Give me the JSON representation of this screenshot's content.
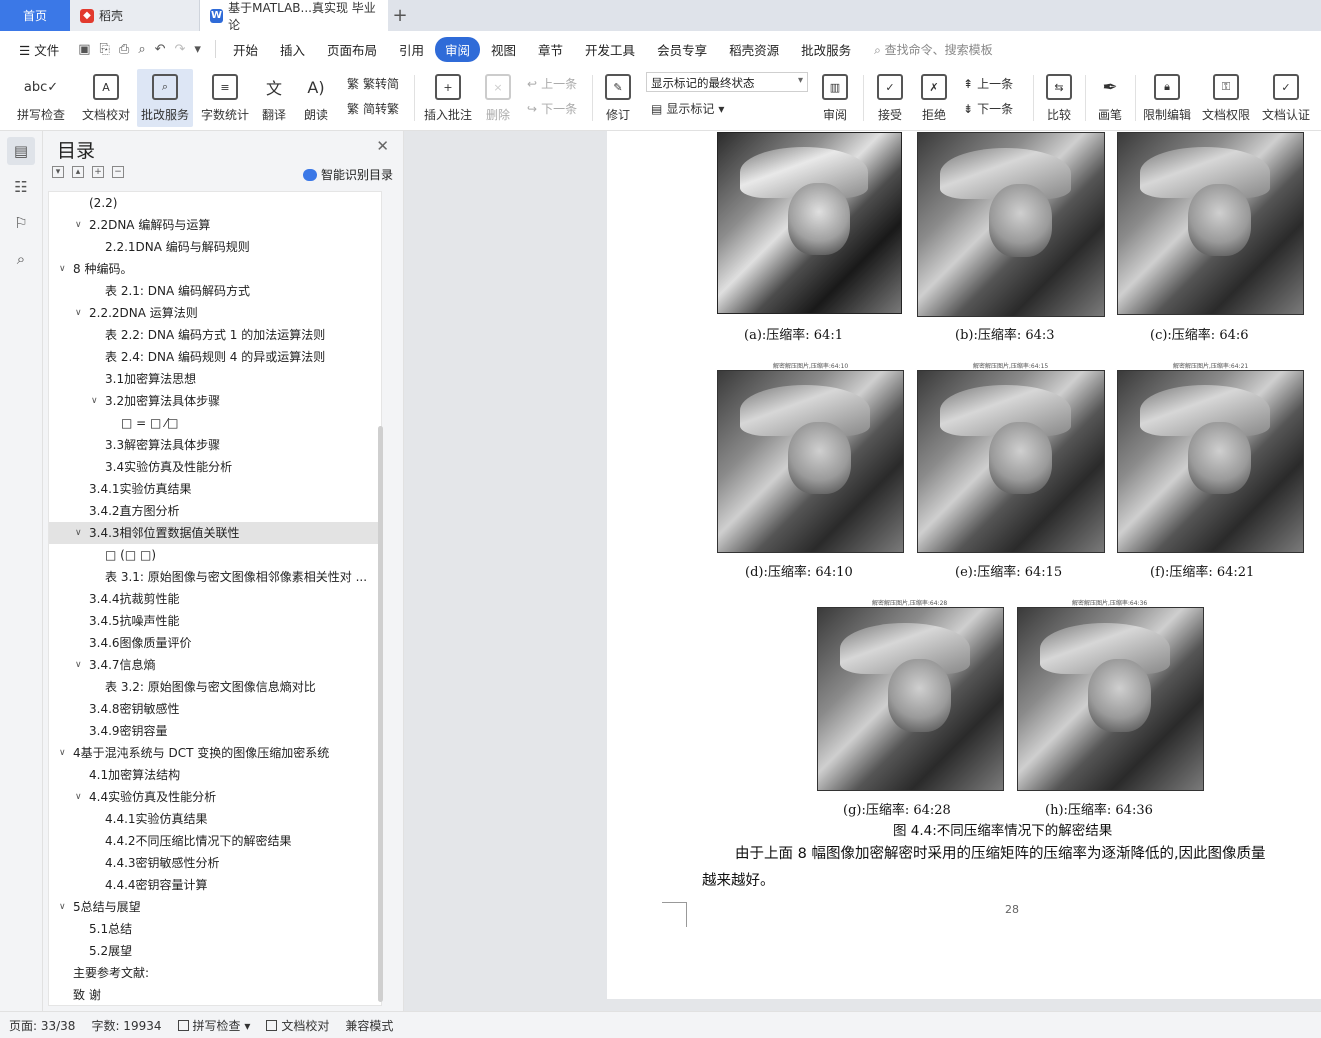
{
  "tabs": {
    "home": "首页",
    "daoke": "稻壳",
    "doc": "基于MATLAB...真实现 毕业论",
    "plus": "+"
  },
  "menu": {
    "file": "文件",
    "items": [
      "开始",
      "插入",
      "页面布局",
      "引用",
      "审阅",
      "视图",
      "章节",
      "开发工具",
      "会员专享",
      "稻壳资源",
      "批改服务"
    ],
    "active": "审阅",
    "search": "查找命令、搜索模板"
  },
  "ribbon": {
    "spell": "拼写检查",
    "proofread": "文档校对",
    "correct": "批改服务",
    "wordcount": "字数统计",
    "translate": "翻译",
    "read": "朗读",
    "trad": "繁转简",
    "simp": "简转繁",
    "insert_comment": "插入批注",
    "delete": "删除",
    "prev": "上一条",
    "next": "下一条",
    "revise": "修订",
    "markup_state": "显示标记的最终状态",
    "show_markup": "显示标记",
    "review": "审阅",
    "accept": "接受",
    "reject": "拒绝",
    "prev2": "上一条",
    "next2": "下一条",
    "compare": "比较",
    "pen": "画笔",
    "restrict": "限制编辑",
    "permission": "文档权限",
    "certify": "文档认证"
  },
  "toc": {
    "title": "目录",
    "smart": "智能识别目录",
    "items": [
      {
        "t": "(2.2)",
        "lvl": 2,
        "arrow": ""
      },
      {
        "t": "2.2DNA 编解码与运算",
        "lvl": 2,
        "arrow": "v"
      },
      {
        "t": "2.2.1DNA 编码与解码规则",
        "lvl": 3,
        "arrow": ""
      },
      {
        "t": "8 种编码。",
        "lvl": 1,
        "arrow": "v"
      },
      {
        "t": "表 2.1:  DNA 编码解码方式",
        "lvl": 3,
        "arrow": ""
      },
      {
        "t": "2.2.2DNA 运算法则",
        "lvl": 2,
        "arrow": "v"
      },
      {
        "t": "表 2.2:  DNA 编码方式 1 的加法运算法则",
        "lvl": 3,
        "arrow": ""
      },
      {
        "t": "表 2.4:  DNA 编码规则 4 的异或运算法则",
        "lvl": 3,
        "arrow": ""
      },
      {
        "t": "3.1加密算法思想",
        "lvl": 3,
        "arrow": ""
      },
      {
        "t": "3.2加密算法具体步骤",
        "lvl": 3,
        "arrow": "v"
      },
      {
        "t": "□ = □  ⁄□",
        "lvl": 4,
        "arrow": ""
      },
      {
        "t": "3.3解密算法具体步骤",
        "lvl": 3,
        "arrow": ""
      },
      {
        "t": "3.4实验仿真及性能分析",
        "lvl": 3,
        "arrow": ""
      },
      {
        "t": "3.4.1实验仿真结果",
        "lvl": 2,
        "arrow": ""
      },
      {
        "t": "3.4.2直方图分析",
        "lvl": 2,
        "arrow": ""
      },
      {
        "t": "3.4.3相邻位置数据值关联性",
        "lvl": 2,
        "arrow": "v",
        "sel": true
      },
      {
        "t": "□  (□ □)",
        "lvl": 3,
        "arrow": ""
      },
      {
        "t": "表 3.1:  原始图像与密文图像相邻像素相关性对 ...",
        "lvl": 3,
        "arrow": ""
      },
      {
        "t": "3.4.4抗裁剪性能",
        "lvl": 2,
        "arrow": ""
      },
      {
        "t": "3.4.5抗噪声性能",
        "lvl": 2,
        "arrow": ""
      },
      {
        "t": "3.4.6图像质量评价",
        "lvl": 2,
        "arrow": ""
      },
      {
        "t": "3.4.7信息熵",
        "lvl": 2,
        "arrow": "v"
      },
      {
        "t": "表 3.2:  原始图像与密文图像信息熵对比",
        "lvl": 3,
        "arrow": ""
      },
      {
        "t": "3.4.8密钥敏感性",
        "lvl": 2,
        "arrow": ""
      },
      {
        "t": "3.4.9密钥容量",
        "lvl": 2,
        "arrow": ""
      },
      {
        "t": "4基于混沌系统与 DCT 变换的图像压缩加密系统",
        "lvl": 1,
        "arrow": "v"
      },
      {
        "t": "4.1加密算法结构",
        "lvl": 2,
        "arrow": ""
      },
      {
        "t": "4.4实验仿真及性能分析",
        "lvl": 2,
        "arrow": "v"
      },
      {
        "t": "4.4.1实验仿真结果",
        "lvl": 3,
        "arrow": ""
      },
      {
        "t": "4.4.2不同压缩比情况下的解密结果",
        "lvl": 3,
        "arrow": ""
      },
      {
        "t": "4.4.3密钥敏感性分析",
        "lvl": 3,
        "arrow": ""
      },
      {
        "t": "4.4.4密钥容量计算",
        "lvl": 3,
        "arrow": ""
      },
      {
        "t": "5总结与展望",
        "lvl": 1,
        "arrow": "v"
      },
      {
        "t": "5.1总结",
        "lvl": 2,
        "arrow": ""
      },
      {
        "t": "5.2展望",
        "lvl": 2,
        "arrow": ""
      },
      {
        "t": "主要参考文献:",
        "lvl": 1,
        "arrow": ""
      },
      {
        "t": "致 谢",
        "lvl": 1,
        "arrow": ""
      }
    ]
  },
  "document": {
    "captions": [
      "(a):压缩率: 64:1",
      "(b):压缩率: 64:3",
      "(c):压缩率: 64:6",
      "(d):压缩率: 64:10",
      "(e):压缩率: 64:15",
      "(f):压缩率: 64:21",
      "(g):压缩率: 64:28",
      "(h):压缩率: 64:36"
    ],
    "image_titles": [
      "解密解压图片,压缩率:64:10",
      "解密解压图片,压缩率:64:15",
      "解密解压图片,压缩率:64:21",
      "解密解压图片,压缩率:64:28",
      "解密解压图片,压缩率:64:36"
    ],
    "figure_caption": "图 4.4:不同压缩率情况下的解密结果",
    "para_line1": "由于上面 8 幅图像加密解密时采用的压缩矩阵的压缩率为逐渐降低的,因此图像质量",
    "para_line2": "越来越好。",
    "page_number": "28"
  },
  "status": {
    "page": "页面: 33/38",
    "words": "字数: 19934",
    "spell": "拼写检查",
    "proof": "文档校对",
    "compat": "兼容模式"
  }
}
